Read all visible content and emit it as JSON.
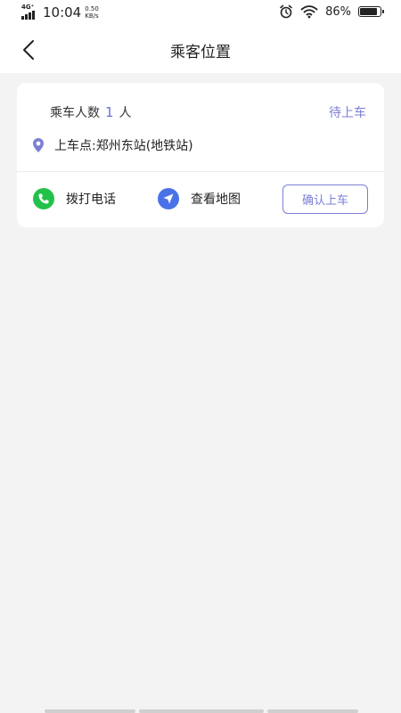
{
  "status_bar": {
    "network": "4G⁺",
    "time": "10:04",
    "speed_value": "0.50",
    "speed_unit": "KB/s",
    "battery_percent": "86%",
    "battery_level": 0.86
  },
  "nav": {
    "title": "乘客位置"
  },
  "card": {
    "count_prefix": "乘车人数",
    "count_value": "1",
    "count_suffix": "人",
    "status": "待上车",
    "pickup": "上车点:郑州东站(地铁站)",
    "call_label": "拨打电话",
    "map_label": "查看地图",
    "confirm_label": "确认上车"
  },
  "colors": {
    "accent": "#7b7fd4",
    "call_green": "#22c24a",
    "map_blue": "#4a72e8"
  }
}
